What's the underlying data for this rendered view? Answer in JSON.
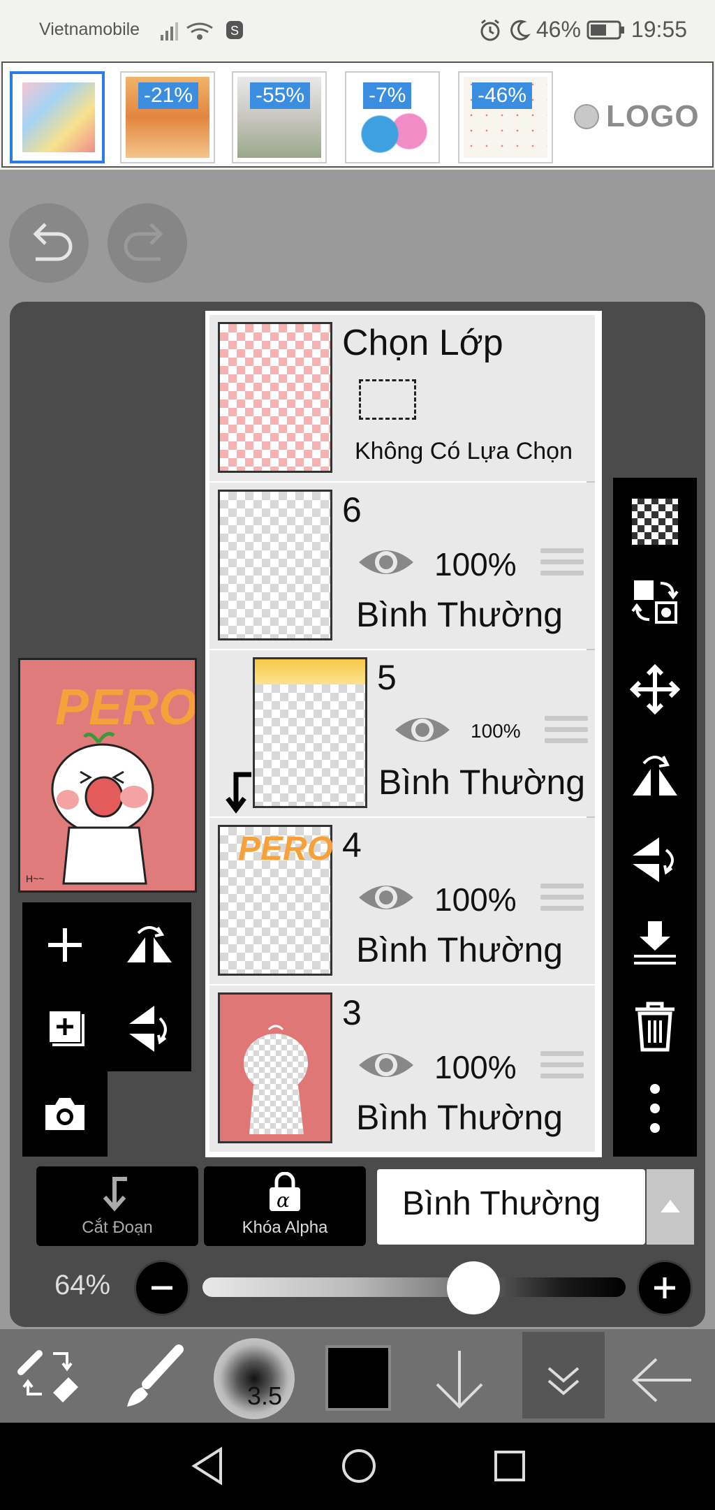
{
  "status_bar": {
    "carrier": "Vietnamobile",
    "battery": "46%",
    "time": "19:55"
  },
  "ad_banner": {
    "discounts": [
      "-21%",
      "-55%",
      "-7%",
      "-46%"
    ],
    "logo_text": "LOGO"
  },
  "layers_panel": {
    "selection_layer": {
      "title": "Chọn Lớp",
      "status": "Không Có Lựa Chọn"
    },
    "layers": [
      {
        "name": "6",
        "opacity": "100%",
        "blend": "Bình Thường"
      },
      {
        "name": "5",
        "opacity": "100%",
        "blend": "Bình Thường",
        "clipped": true
      },
      {
        "name": "4",
        "opacity": "100%",
        "blend": "Bình Thường"
      },
      {
        "name": "3",
        "opacity": "100%",
        "blend": "Bình Thường"
      }
    ]
  },
  "preview": {
    "title_art": "PERO"
  },
  "controls": {
    "clip_label": "Cắt Đoạn",
    "alpha_lock_label": "Khóa Alpha",
    "blend_mode": "Bình Thường",
    "opacity_label": "64%",
    "opacity_value": 0.64
  },
  "bottom_toolbar": {
    "brush_size": "3.5"
  },
  "colors": {
    "accent_blue": "#3b8de0",
    "canvas_pink": "#df7b7b",
    "pero_orange": "#f6a13a"
  }
}
